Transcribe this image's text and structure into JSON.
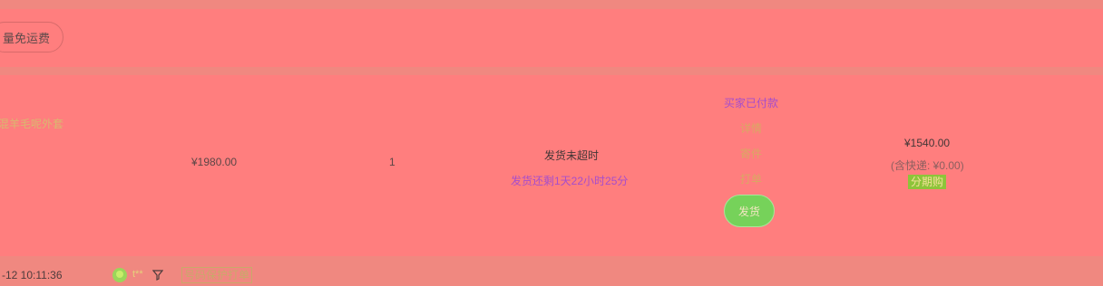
{
  "promo": {
    "label": "量免运费"
  },
  "order": {
    "product_name": "混羊毛呢外套",
    "unit_price": "¥1980.00",
    "quantity": "1",
    "ship_status": "发货未超时",
    "ship_remaining": "发货还剩1天22小时25分",
    "ops": {
      "paid": "买家已付款",
      "detail": "详情",
      "send": "寄件",
      "print": "打单",
      "ship_button": "发货"
    },
    "total_price": "¥1540.00",
    "shipping_note": "(含快递: ¥0.00)",
    "installment": "分期购"
  },
  "footer": {
    "time": "-12 10:11:36",
    "user": "t**",
    "tag": "号码保护打单",
    "icons": [
      "leaf-avatar-icon",
      "filter-icon"
    ]
  },
  "colors": {
    "background": "#ff7e7e",
    "strip": "#f08880",
    "accent_purple": "#a64dcc",
    "link": "#d9a863",
    "button_green": "#76d25a",
    "badge_green": "#8dc43a"
  }
}
